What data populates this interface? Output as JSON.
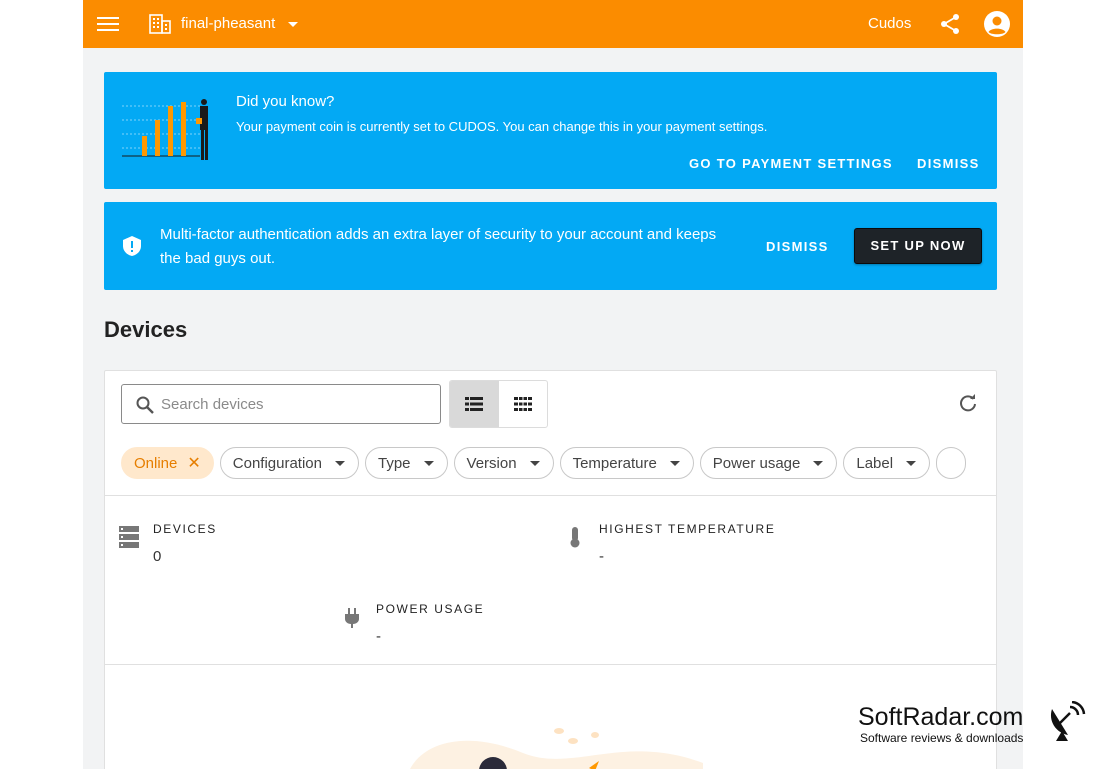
{
  "topbar": {
    "org_name": "final-pheasant",
    "coin_label": "Cudos",
    "icons": [
      "menu-icon",
      "building-icon",
      "caret-down-icon",
      "share-icon",
      "account-circle-icon"
    ]
  },
  "tip_banner": {
    "title": "Did you know?",
    "message": "Your payment coin is currently set to CUDOS. You can change this in your payment settings.",
    "go_button": "GO TO PAYMENT SETTINGS",
    "dismiss_button": "DISMISS"
  },
  "mfa_banner": {
    "message": "Multi-factor authentication adds an extra layer of security to your account and keeps the bad guys out.",
    "dismiss_button": "DISMISS",
    "setup_button": "SET UP NOW"
  },
  "page_title": "Devices",
  "search": {
    "placeholder": "Search devices"
  },
  "filters": {
    "active": "Online",
    "chips": [
      "Configuration",
      "Type",
      "Version",
      "Temperature",
      "Power usage",
      "Label"
    ]
  },
  "stats": {
    "devices": {
      "label": "DEVICES",
      "value": "0"
    },
    "highest_temperature": {
      "label": "HIGHEST TEMPERATURE",
      "value": "-"
    },
    "power_usage": {
      "label": "POWER USAGE",
      "value": "-"
    }
  },
  "watermark": {
    "title": "SoftRadar.com",
    "subtitle": "Software reviews & downloads"
  },
  "colors": {
    "topbar": "#fb8c00",
    "banner": "#03a9f4",
    "setup_button": "#1e2328",
    "active_chip_bg": "#ffe8cc",
    "active_chip_text": "#e67e00"
  }
}
